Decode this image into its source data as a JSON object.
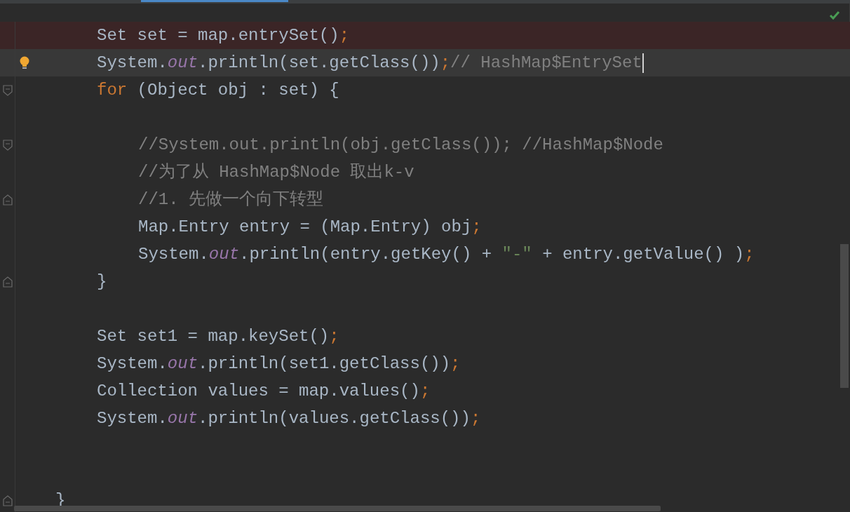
{
  "editor": {
    "lines": [
      {
        "kind": "code",
        "highlighted": true,
        "current": false,
        "bulb": false,
        "caret": false,
        "fold_start": false,
        "fold_end": false,
        "tokens": [
          {
            "kind": "plain",
            "text": "Set set = map.entrySet()"
          },
          {
            "kind": "semi",
            "text": ";"
          }
        ]
      },
      {
        "kind": "code",
        "highlighted": false,
        "current": true,
        "bulb": true,
        "caret": true,
        "fold_start": false,
        "fold_end": false,
        "tokens": [
          {
            "kind": "plain",
            "text": "System."
          },
          {
            "kind": "field",
            "text": "out"
          },
          {
            "kind": "plain",
            "text": ".println(set.getClass())"
          },
          {
            "kind": "semi",
            "text": ";"
          },
          {
            "kind": "comment",
            "text": "// HashMap$EntrySet"
          }
        ]
      },
      {
        "kind": "code",
        "highlighted": false,
        "current": false,
        "bulb": false,
        "caret": false,
        "fold_start": true,
        "fold_end": false,
        "tokens": [
          {
            "kind": "keyword",
            "text": "for"
          },
          {
            "kind": "plain",
            "text": " (Object obj : set) {"
          }
        ],
        "children": [
          {
            "kind": "blank"
          },
          {
            "kind": "code",
            "highlighted": false,
            "current": false,
            "bulb": false,
            "caret": false,
            "fold_start": true,
            "fold_end": false,
            "tokens": [
              {
                "kind": "comment",
                "text": "//System.out.println(obj.getClass()); //HashMap$Node"
              }
            ]
          },
          {
            "kind": "code",
            "highlighted": false,
            "current": false,
            "bulb": false,
            "caret": false,
            "fold_start": false,
            "fold_end": false,
            "tokens": [
              {
                "kind": "comment",
                "text": "//为了从 HashMap$Node 取出k-v"
              }
            ]
          },
          {
            "kind": "code",
            "highlighted": false,
            "current": false,
            "bulb": false,
            "caret": false,
            "fold_start": false,
            "fold_end": true,
            "tokens": [
              {
                "kind": "comment",
                "text": "//1. 先做一个向下转型"
              }
            ]
          },
          {
            "kind": "code",
            "highlighted": false,
            "current": false,
            "bulb": false,
            "caret": false,
            "fold_start": false,
            "fold_end": false,
            "tokens": [
              {
                "kind": "plain",
                "text": "Map.Entry entry = (Map.Entry) obj"
              },
              {
                "kind": "semi",
                "text": ";"
              }
            ]
          },
          {
            "kind": "code",
            "highlighted": false,
            "current": false,
            "bulb": false,
            "caret": false,
            "fold_start": false,
            "fold_end": false,
            "tokens": [
              {
                "kind": "plain",
                "text": "System."
              },
              {
                "kind": "field",
                "text": "out"
              },
              {
                "kind": "plain",
                "text": ".println(entry.getKey() + "
              },
              {
                "kind": "string",
                "text": "\"-\""
              },
              {
                "kind": "plain",
                "text": " + entry.getValue() )"
              },
              {
                "kind": "semi",
                "text": ";"
              }
            ]
          }
        ]
      },
      {
        "kind": "code",
        "highlighted": false,
        "current": false,
        "bulb": false,
        "caret": false,
        "fold_start": false,
        "fold_end": true,
        "tokens": [
          {
            "kind": "plain",
            "text": "}"
          }
        ]
      },
      {
        "kind": "blank"
      },
      {
        "kind": "code",
        "highlighted": false,
        "current": false,
        "bulb": false,
        "caret": false,
        "fold_start": false,
        "fold_end": false,
        "tokens": [
          {
            "kind": "plain",
            "text": "Set set1 = map.keySet()"
          },
          {
            "kind": "semi",
            "text": ";"
          }
        ]
      },
      {
        "kind": "code",
        "highlighted": false,
        "current": false,
        "bulb": false,
        "caret": false,
        "fold_start": false,
        "fold_end": false,
        "tokens": [
          {
            "kind": "plain",
            "text": "System."
          },
          {
            "kind": "field",
            "text": "out"
          },
          {
            "kind": "plain",
            "text": ".println(set1.getClass())"
          },
          {
            "kind": "semi",
            "text": ";"
          }
        ]
      },
      {
        "kind": "code",
        "highlighted": false,
        "current": false,
        "bulb": false,
        "caret": false,
        "fold_start": false,
        "fold_end": false,
        "tokens": [
          {
            "kind": "plain",
            "text": "Collection values = map.values()"
          },
          {
            "kind": "semi",
            "text": ";"
          }
        ]
      },
      {
        "kind": "code",
        "highlighted": false,
        "current": false,
        "bulb": false,
        "caret": false,
        "fold_start": false,
        "fold_end": false,
        "tokens": [
          {
            "kind": "plain",
            "text": "System."
          },
          {
            "kind": "field",
            "text": "out"
          },
          {
            "kind": "plain",
            "text": ".println(values.getClass())"
          },
          {
            "kind": "semi",
            "text": ";"
          }
        ]
      },
      {
        "kind": "blank"
      },
      {
        "kind": "blank"
      }
    ],
    "outer_lines": [
      {
        "kind": "code",
        "highlighted": false,
        "current": false,
        "bulb": false,
        "caret": false,
        "fold_start": false,
        "fold_end": true,
        "tokens": [
          {
            "kind": "plain",
            "text": "}"
          }
        ]
      }
    ]
  }
}
